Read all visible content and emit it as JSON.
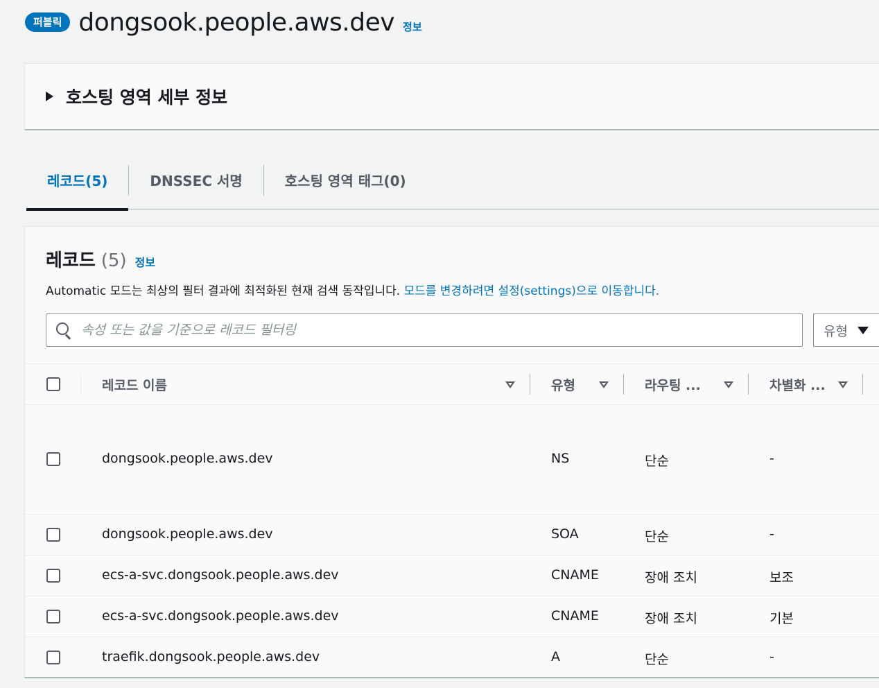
{
  "header": {
    "badge": "퍼블릭",
    "title": "dongsook.people.aws.dev",
    "info": "정보"
  },
  "details": {
    "title": "호스팅 영역 세부 정보"
  },
  "tabs": [
    {
      "label": "레코드(5)",
      "active": true
    },
    {
      "label": "DNSSEC 서명",
      "active": false
    },
    {
      "label": "호스팅 영역 태그(0)",
      "active": false
    }
  ],
  "records": {
    "title": "레코드",
    "count": "(5)",
    "info": "정보",
    "description": "Automatic 모드는 최상의 필터 결과에 최적화된 현재 검색 동작입니다.",
    "description_link": "모드를 변경하려면 설정(settings)으로 이동합니다.",
    "search_placeholder": "속성 또는 값을 기준으로 레코드 필터링",
    "type_filter": "유형",
    "columns": [
      "레코드 이름",
      "유형",
      "라우팅 ...",
      "차별화 ..."
    ],
    "rows": [
      {
        "name": "dongsook.people.aws.dev",
        "type": "NS",
        "routing": "단순",
        "diff": "-"
      },
      {
        "name": "dongsook.people.aws.dev",
        "type": "SOA",
        "routing": "단순",
        "diff": "-"
      },
      {
        "name": "ecs-a-svc.dongsook.people.aws.dev",
        "type": "CNAME",
        "routing": "장애 조치",
        "diff": "보조"
      },
      {
        "name": "ecs-a-svc.dongsook.people.aws.dev",
        "type": "CNAME",
        "routing": "장애 조치",
        "diff": "기본"
      },
      {
        "name": "traefik.dongsook.people.aws.dev",
        "type": "A",
        "routing": "단순",
        "diff": "-"
      }
    ]
  },
  "colors": {
    "accent": "#0073bb",
    "text": "#16191f",
    "background": "#f2f3f3"
  }
}
